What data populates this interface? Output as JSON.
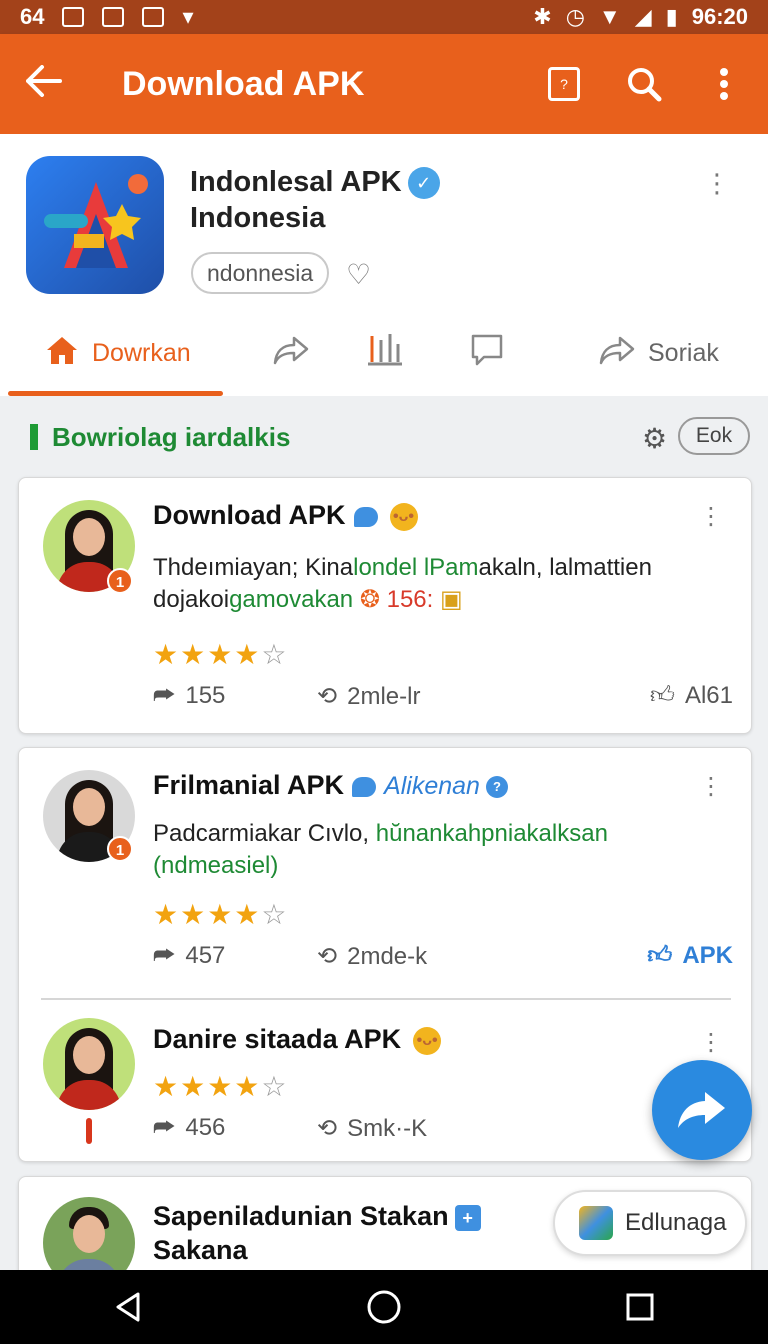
{
  "status_bar": {
    "left_text": "64",
    "time": "96:20"
  },
  "app_bar": {
    "title": "Download APK"
  },
  "app_header": {
    "name_line1": "Indonlesal APK",
    "name_line2": "Indonesia",
    "chip": "ndonnesia"
  },
  "tabs": [
    {
      "label": "Dowrkan",
      "icon": "home-icon",
      "active": true
    },
    {
      "label": "",
      "icon": "share-icon"
    },
    {
      "label": "",
      "icon": "bars-icon"
    },
    {
      "label": "",
      "icon": "comment-icon"
    },
    {
      "label": "Soriak",
      "icon": "share-icon"
    }
  ],
  "section": {
    "title": "Bowriolag iardalkis",
    "sort_label": "Eok"
  },
  "posts": [
    {
      "name": "Download APK",
      "badge": "1",
      "text_a": "Thdeımiayan; Kina",
      "text_b": "londel lPam",
      "text_c": "akaln, lalmattien",
      "text_d": "dojakoi",
      "text_e": "gamovakan",
      "text_f": " 156:",
      "rating": 4,
      "shares": "155",
      "reposts": "2mle-lr",
      "likes": "Al61"
    },
    {
      "name": "Frilmanial APK",
      "handle": "Alikenan",
      "badge": "1",
      "text_a": "Padcarmiakar Cıvlo, ",
      "text_b": "hŭnankahpniakalksan",
      "text_c": "(ndmeasiel)",
      "rating": 4,
      "shares": "457",
      "reposts": "2mde-k",
      "likes": "APK"
    },
    {
      "name": "Danire sitaada APK",
      "rating": 4,
      "shares": "456",
      "reposts": "Smk·-K"
    },
    {
      "name_line1": "Sapeniladunian Stakan",
      "name_line2": "Sakana"
    }
  ],
  "chip_button": {
    "label": "Edlunaga"
  },
  "colors": {
    "primary": "#e8601c",
    "accent_blue": "#2a8ae0",
    "green": "#1e8a34",
    "star": "#f2a310"
  }
}
